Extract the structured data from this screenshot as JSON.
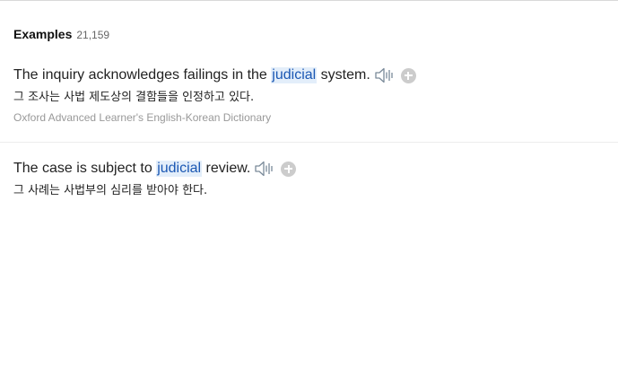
{
  "examples_header": {
    "title": "Examples",
    "count": "21,159"
  },
  "examples": [
    {
      "before": "The inquiry acknowledges failings in the ",
      "highlight": "judicial",
      "after": " system.",
      "translation": "그 조사는 사법 제도상의 결함들을 인정하고 있다.",
      "source": "Oxford Advanced Learner's English-Korean Dictionary",
      "speaker_icon": "speaker-icon",
      "add_icon": "plus-circle-icon"
    },
    {
      "before": "The case is subject to ",
      "highlight": "judicial",
      "after": " review.",
      "translation": "그 사례는 사법부의 심리를 받아야 한다.",
      "speaker_icon": "speaker-icon",
      "add_icon": "plus-circle-icon"
    }
  ],
  "colors": {
    "highlight_bg": "#e3eefa",
    "highlight_text": "#1a57b3",
    "add_button": "#cccccc",
    "speaker": "#7a8a99"
  }
}
